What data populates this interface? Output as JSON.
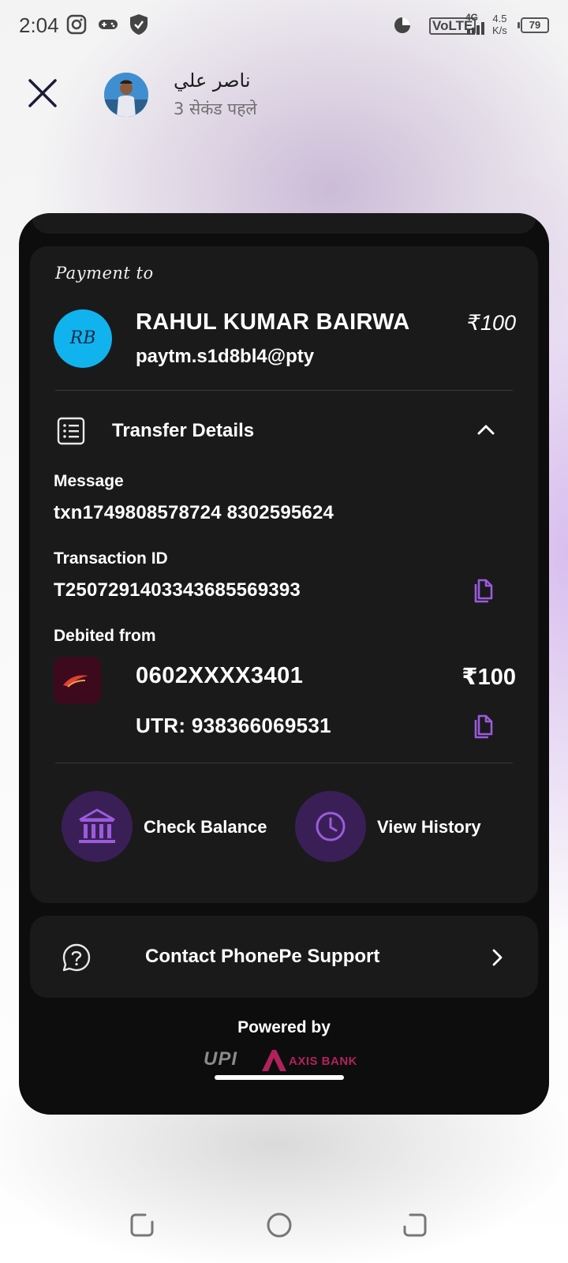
{
  "status_bar": {
    "time": "2:04",
    "network": "VoLTE",
    "network_gen": "4G",
    "speed_value": "4.5",
    "speed_unit": "K/s",
    "battery": "79"
  },
  "header": {
    "sender_name": "ناصر علي",
    "sender_time": "3 सेकंड पहले"
  },
  "payment": {
    "section_label": "Payment to",
    "payee_initials": "RB",
    "payee_name": "RAHUL KUMAR BAIRWA",
    "payee_amount": "₹100",
    "payee_upi": "paytm.s1d8bl4@pty",
    "avatar_color": "#11b3ee"
  },
  "transfer_details": {
    "title": "Transfer Details",
    "message_label": "Message",
    "message_value": "txn1749808578724  8302595624",
    "txn_label": "Transaction ID",
    "txn_value": "T2507291403343685569393",
    "debited_label": "Debited from",
    "account": "0602XXXX3401",
    "account_amount": "₹100",
    "utr": "UTR: 938366069531"
  },
  "actions": {
    "check_balance": "Check Balance",
    "view_history": "View History",
    "accent": "#7a3fb5"
  },
  "support": {
    "label": "Contact PhonePe Support"
  },
  "footer": {
    "powered_by": "Powered by",
    "upi": "UPI",
    "bank": "AXIS BANK"
  },
  "icons": {
    "close": "close-icon",
    "list": "list-icon",
    "chevron_up": "chevron-up-icon",
    "copy": "copy-icon",
    "bank": "bank-icon",
    "clock": "clock-icon",
    "help": "help-icon",
    "chevron_right": "chevron-right-icon"
  }
}
